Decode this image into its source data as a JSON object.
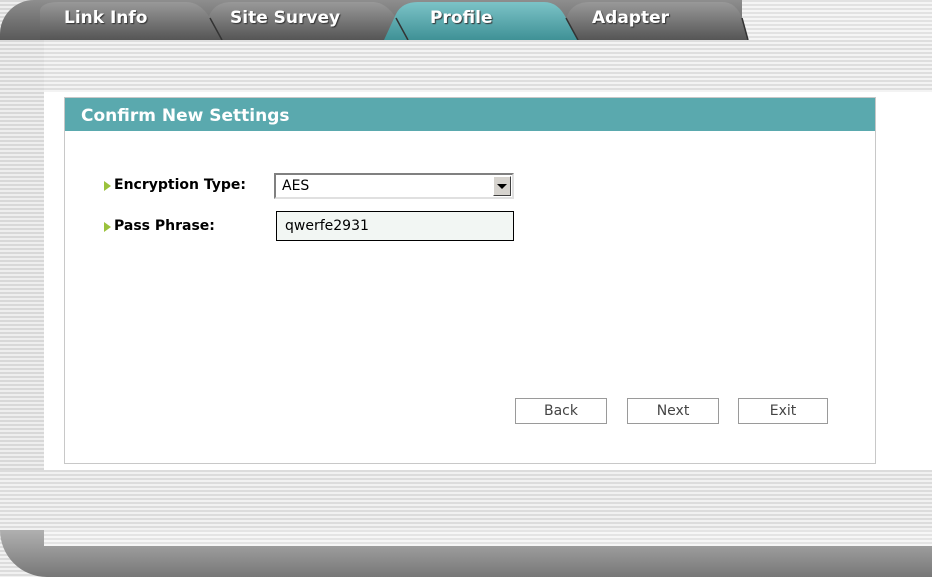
{
  "tabs": [
    {
      "label": "Link Info"
    },
    {
      "label": "Site Survey"
    },
    {
      "label": "Profile"
    },
    {
      "label": "Adapter"
    }
  ],
  "active_tab": "Profile",
  "panel": {
    "title": "Confirm New Settings",
    "encryption_label": "Encryption Type:",
    "encryption_value": "AES",
    "passphrase_label": "Pass Phrase:",
    "passphrase_value": "qwerfe2931"
  },
  "buttons": {
    "back": "Back",
    "next": "Next",
    "exit": "Exit"
  },
  "colors": {
    "header_accent": "#5aa9ae",
    "active_tab": "#4f9ea3",
    "bullet": "#9bc23c"
  }
}
